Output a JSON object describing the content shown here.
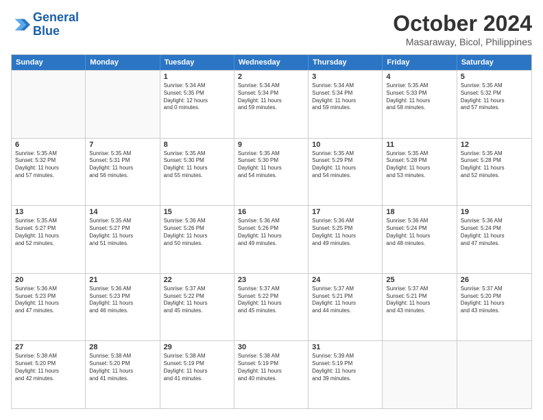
{
  "logo": {
    "line1": "General",
    "line2": "Blue"
  },
  "title": "October 2024",
  "subtitle": "Masaraway, Bicol, Philippines",
  "header_days": [
    "Sunday",
    "Monday",
    "Tuesday",
    "Wednesday",
    "Thursday",
    "Friday",
    "Saturday"
  ],
  "weeks": [
    [
      {
        "day": "",
        "info": ""
      },
      {
        "day": "",
        "info": ""
      },
      {
        "day": "1",
        "info": "Sunrise: 5:34 AM\nSunset: 5:35 PM\nDaylight: 12 hours\nand 0 minutes."
      },
      {
        "day": "2",
        "info": "Sunrise: 5:34 AM\nSunset: 5:34 PM\nDaylight: 11 hours\nand 59 minutes."
      },
      {
        "day": "3",
        "info": "Sunrise: 5:34 AM\nSunset: 5:34 PM\nDaylight: 11 hours\nand 59 minutes."
      },
      {
        "day": "4",
        "info": "Sunrise: 5:35 AM\nSunset: 5:33 PM\nDaylight: 11 hours\nand 58 minutes."
      },
      {
        "day": "5",
        "info": "Sunrise: 5:35 AM\nSunset: 5:32 PM\nDaylight: 11 hours\nand 57 minutes."
      }
    ],
    [
      {
        "day": "6",
        "info": "Sunrise: 5:35 AM\nSunset: 5:32 PM\nDaylight: 11 hours\nand 57 minutes."
      },
      {
        "day": "7",
        "info": "Sunrise: 5:35 AM\nSunset: 5:31 PM\nDaylight: 11 hours\nand 56 minutes."
      },
      {
        "day": "8",
        "info": "Sunrise: 5:35 AM\nSunset: 5:30 PM\nDaylight: 11 hours\nand 55 minutes."
      },
      {
        "day": "9",
        "info": "Sunrise: 5:35 AM\nSunset: 5:30 PM\nDaylight: 11 hours\nand 54 minutes."
      },
      {
        "day": "10",
        "info": "Sunrise: 5:35 AM\nSunset: 5:29 PM\nDaylight: 11 hours\nand 54 minutes."
      },
      {
        "day": "11",
        "info": "Sunrise: 5:35 AM\nSunset: 5:28 PM\nDaylight: 11 hours\nand 53 minutes."
      },
      {
        "day": "12",
        "info": "Sunrise: 5:35 AM\nSunset: 5:28 PM\nDaylight: 11 hours\nand 52 minutes."
      }
    ],
    [
      {
        "day": "13",
        "info": "Sunrise: 5:35 AM\nSunset: 5:27 PM\nDaylight: 11 hours\nand 52 minutes."
      },
      {
        "day": "14",
        "info": "Sunrise: 5:35 AM\nSunset: 5:27 PM\nDaylight: 11 hours\nand 51 minutes."
      },
      {
        "day": "15",
        "info": "Sunrise: 5:36 AM\nSunset: 5:26 PM\nDaylight: 11 hours\nand 50 minutes."
      },
      {
        "day": "16",
        "info": "Sunrise: 5:36 AM\nSunset: 5:26 PM\nDaylight: 11 hours\nand 49 minutes."
      },
      {
        "day": "17",
        "info": "Sunrise: 5:36 AM\nSunset: 5:25 PM\nDaylight: 11 hours\nand 49 minutes."
      },
      {
        "day": "18",
        "info": "Sunrise: 5:36 AM\nSunset: 5:24 PM\nDaylight: 11 hours\nand 48 minutes."
      },
      {
        "day": "19",
        "info": "Sunrise: 5:36 AM\nSunset: 5:24 PM\nDaylight: 11 hours\nand 47 minutes."
      }
    ],
    [
      {
        "day": "20",
        "info": "Sunrise: 5:36 AM\nSunset: 5:23 PM\nDaylight: 11 hours\nand 47 minutes."
      },
      {
        "day": "21",
        "info": "Sunrise: 5:36 AM\nSunset: 5:23 PM\nDaylight: 11 hours\nand 46 minutes."
      },
      {
        "day": "22",
        "info": "Sunrise: 5:37 AM\nSunset: 5:22 PM\nDaylight: 11 hours\nand 45 minutes."
      },
      {
        "day": "23",
        "info": "Sunrise: 5:37 AM\nSunset: 5:22 PM\nDaylight: 11 hours\nand 45 minutes."
      },
      {
        "day": "24",
        "info": "Sunrise: 5:37 AM\nSunset: 5:21 PM\nDaylight: 11 hours\nand 44 minutes."
      },
      {
        "day": "25",
        "info": "Sunrise: 5:37 AM\nSunset: 5:21 PM\nDaylight: 11 hours\nand 43 minutes."
      },
      {
        "day": "26",
        "info": "Sunrise: 5:37 AM\nSunset: 5:20 PM\nDaylight: 11 hours\nand 43 minutes."
      }
    ],
    [
      {
        "day": "27",
        "info": "Sunrise: 5:38 AM\nSunset: 5:20 PM\nDaylight: 11 hours\nand 42 minutes."
      },
      {
        "day": "28",
        "info": "Sunrise: 5:38 AM\nSunset: 5:20 PM\nDaylight: 11 hours\nand 41 minutes."
      },
      {
        "day": "29",
        "info": "Sunrise: 5:38 AM\nSunset: 5:19 PM\nDaylight: 11 hours\nand 41 minutes."
      },
      {
        "day": "30",
        "info": "Sunrise: 5:38 AM\nSunset: 5:19 PM\nDaylight: 11 hours\nand 40 minutes."
      },
      {
        "day": "31",
        "info": "Sunrise: 5:39 AM\nSunset: 5:19 PM\nDaylight: 11 hours\nand 39 minutes."
      },
      {
        "day": "",
        "info": ""
      },
      {
        "day": "",
        "info": ""
      }
    ]
  ]
}
